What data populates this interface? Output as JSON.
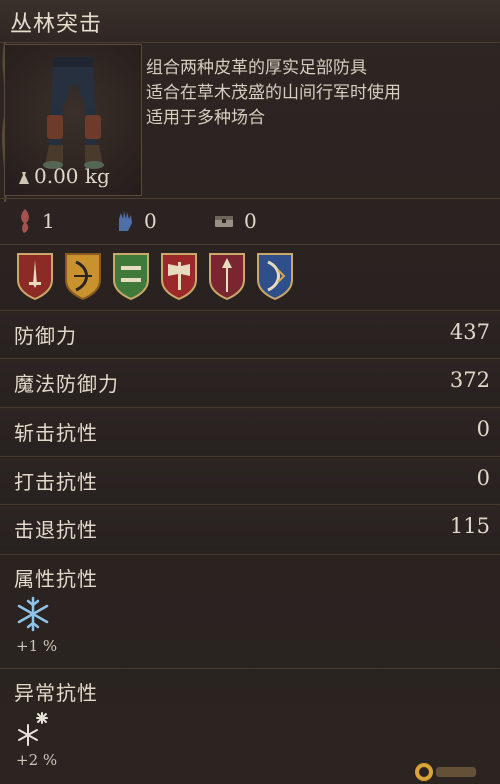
{
  "item": {
    "name": "丛林突击",
    "weight": "0.00 kg",
    "description": [
      "组合两种皮革的厚实足部防具",
      "适合在草木茂盛的山间行军时使用",
      "适用于多种场合"
    ]
  },
  "requirements": [
    {
      "icon": "strength-icon",
      "value": "1"
    },
    {
      "icon": "dexterity-hand-icon",
      "value": "0"
    },
    {
      "icon": "item-chest-icon",
      "value": "0"
    }
  ],
  "weapon_shields": [
    {
      "icon": "sword-shield-icon",
      "color": "#8c2a26"
    },
    {
      "icon": "bow-shield-icon",
      "color": "#c8932e"
    },
    {
      "icon": "crossbow-shield-icon",
      "color": "#3f7a3a"
    },
    {
      "icon": "axe-shield-icon",
      "color": "#9a2a2a"
    },
    {
      "icon": "spear-shield-icon",
      "color": "#7a2630"
    },
    {
      "icon": "magic-bow-shield-icon",
      "color": "#2f4f8a"
    }
  ],
  "stats": [
    {
      "label": "防御力",
      "value": "437"
    },
    {
      "label": "魔法防御力",
      "value": "372"
    },
    {
      "label": "斩击抗性",
      "value": "0"
    },
    {
      "label": "打击抗性",
      "value": "0"
    },
    {
      "label": "击退抗性",
      "value": "115"
    }
  ],
  "attribute_resistance": {
    "label": "属性抗性",
    "icon": "snowflake-icon",
    "value": "+1 %"
  },
  "status_resistance": {
    "label": "异常抗性",
    "icon": "frost-crystals-icon",
    "value": "+2 %"
  }
}
